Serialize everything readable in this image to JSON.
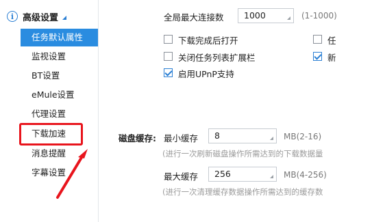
{
  "sidebar": {
    "group_label": "高级设置",
    "items": [
      {
        "label": "任务默认属性",
        "active": true
      },
      {
        "label": "监视设置"
      },
      {
        "label": "BT设置"
      },
      {
        "label": "eMule设置"
      },
      {
        "label": "代理设置"
      },
      {
        "label": "下载加速"
      },
      {
        "label": "消息提醒"
      },
      {
        "label": "字幕设置"
      }
    ]
  },
  "main": {
    "max_connections_label": "全局最大连接数",
    "max_connections_value": "1000",
    "max_connections_range": "(1-1000)",
    "checkboxes": [
      {
        "label": "下载完成后打开",
        "checked": false
      },
      {
        "label": "任",
        "checked": false
      },
      {
        "label": "关闭任务列表扩展栏",
        "checked": false
      },
      {
        "label": "新",
        "checked": true
      },
      {
        "label": "启用UPnP支持",
        "checked": true
      }
    ],
    "disk_cache_label": "磁盘缓存:",
    "min_cache_label": "最小缓存",
    "min_cache_value": "8",
    "min_cache_range": "MB(2-16)",
    "min_cache_hint": "(进行一次刷新磁盘操作所需达到的下载数据量",
    "max_cache_label": "最大缓存",
    "max_cache_value": "256",
    "max_cache_range": "MB(4-256)",
    "max_cache_hint": "(进行一次清理缓存数据操作所需达到的缓存数"
  },
  "annotation": {
    "color": "#e8141c"
  }
}
